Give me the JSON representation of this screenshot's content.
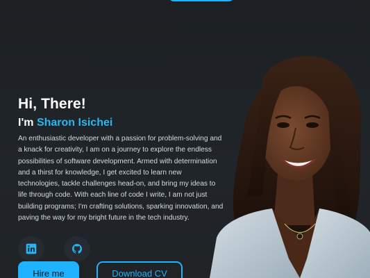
{
  "hero": {
    "greeting": "Hi, There!",
    "name_prefix": "I'm",
    "name": "Sharon Isichei",
    "bio": "An enthusiastic developer with a passion for problem-solving and a knack for creativity, I am on a journey to explore the endless possibilities of software development. Armed with determination and a thirst for knowledge, I get excited to learn new technologies, tackle challenges head-on, and bring my ideas to life through code. With each line of code I write, I am not just building programs; I'm crafting solutions, sparking innovation, and paving the way for my bright future in the tech industry."
  },
  "socials": [
    {
      "icon": "linkedin-icon"
    },
    {
      "icon": "github-icon"
    }
  ],
  "buttons": {
    "hire": "Hire me",
    "download": "Download CV"
  },
  "colors": {
    "accent": "#1fb3ff",
    "name": "#2ab6f2",
    "background": "#1f2326"
  }
}
